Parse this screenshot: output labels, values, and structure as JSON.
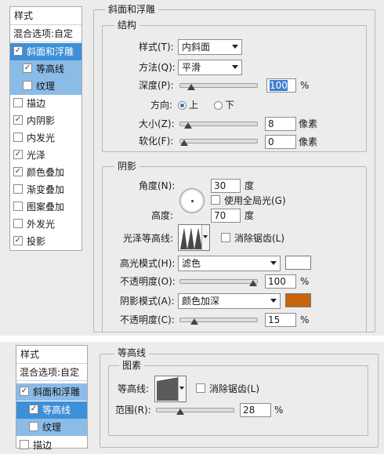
{
  "top": {
    "sidebar": {
      "header": "样式",
      "blend": "混合选项:自定",
      "items": [
        {
          "label": "斜面和浮雕",
          "checked": true
        },
        {
          "label": "等高线",
          "checked": true
        },
        {
          "label": "纹理",
          "checked": false
        },
        {
          "label": "描边",
          "checked": false
        },
        {
          "label": "内阴影",
          "checked": true
        },
        {
          "label": "内发光",
          "checked": false
        },
        {
          "label": "光泽",
          "checked": true
        },
        {
          "label": "颜色叠加",
          "checked": true
        },
        {
          "label": "渐变叠加",
          "checked": false
        },
        {
          "label": "图案叠加",
          "checked": false
        },
        {
          "label": "外发光",
          "checked": false
        },
        {
          "label": "投影",
          "checked": true
        }
      ]
    },
    "section_title": "斜面和浮雕",
    "structure": {
      "title": "结构",
      "style_label": "样式(T):",
      "style_value": "内斜面",
      "technique_label": "方法(Q):",
      "technique_value": "平滑",
      "depth_label": "深度(P):",
      "depth_value": "100",
      "depth_unit": "%",
      "depth_slider": 0.1,
      "direction_label": "方向:",
      "dir_up": "上",
      "dir_down": "下",
      "size_label": "大小(Z):",
      "size_value": "8",
      "size_unit": "像素",
      "size_slider": 0.06,
      "soften_label": "软化(F):",
      "soften_value": "0",
      "soften_unit": "像素",
      "soften_slider": 0.0
    },
    "shading": {
      "title": "阴影",
      "angle_label": "角度(N):",
      "angle_value": "30",
      "angle_unit": "度",
      "global_light_label": "使用全局光(G)",
      "altitude_label": "高度:",
      "altitude_value": "70",
      "altitude_unit": "度",
      "gloss_label": "光泽等高线:",
      "antialias_label": "消除锯齿(L)",
      "highlight_mode_label": "高光模式(H):",
      "highlight_mode_value": "滤色",
      "highlight_color": "#ffffff",
      "highlight_opacity_label": "不透明度(O):",
      "highlight_opacity_value": "100",
      "highlight_opacity_unit": "%",
      "highlight_opacity_slider": 1.0,
      "shadow_mode_label": "阴影模式(A):",
      "shadow_mode_value": "颜色加深",
      "shadow_color": "#c8640c",
      "shadow_opacity_label": "不透明度(C):",
      "shadow_opacity_value": "15",
      "shadow_opacity_unit": "%",
      "shadow_opacity_slider": 0.15
    }
  },
  "bottom": {
    "sidebar": {
      "header": "样式",
      "blend": "混合选项:自定",
      "items": [
        {
          "label": "斜面和浮雕",
          "checked": true
        },
        {
          "label": "等高线",
          "checked": true
        },
        {
          "label": "纹理",
          "checked": false
        },
        {
          "label": "描边",
          "checked": false
        }
      ]
    },
    "section_title": "等高线",
    "elements": {
      "title": "图素",
      "contour_label": "等高线:",
      "antialias_label": "消除锯齿(L)",
      "range_label": "范围(R):",
      "range_value": "28",
      "range_unit": "%",
      "range_slider": 0.28
    }
  }
}
